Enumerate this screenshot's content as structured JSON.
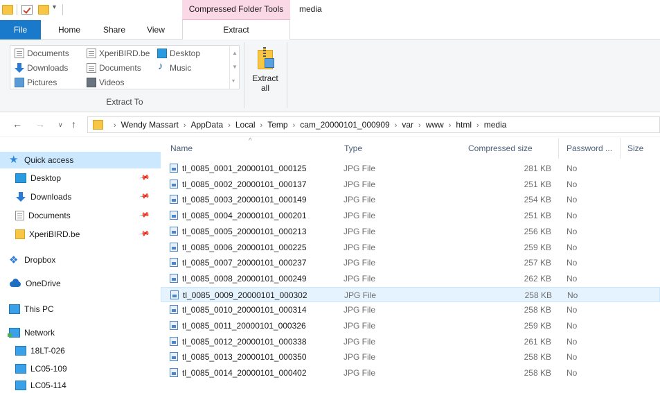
{
  "titlebar": {
    "context_tab": "Compressed Folder Tools",
    "window_title": "media"
  },
  "tabs": {
    "file": "File",
    "home": "Home",
    "share": "Share",
    "view": "View",
    "extract": "Extract"
  },
  "ribbon": {
    "destinations": [
      {
        "label": "Documents",
        "icon": "documents-icon"
      },
      {
        "label": "XperiBIRD.be",
        "icon": "folder-icon"
      },
      {
        "label": "Desktop",
        "icon": "desktop-icon"
      },
      {
        "label": "Downloads",
        "icon": "downloads-icon"
      },
      {
        "label": "Documents",
        "icon": "documents-icon"
      },
      {
        "label": "Music",
        "icon": "music-icon"
      },
      {
        "label": "Pictures",
        "icon": "pictures-icon"
      },
      {
        "label": "Videos",
        "icon": "videos-icon"
      }
    ],
    "group_label": "Extract To",
    "extract_all_line1": "Extract",
    "extract_all_line2": "all"
  },
  "address": {
    "crumbs": [
      "Wendy Massart",
      "AppData",
      "Local",
      "Temp",
      "cam_20000101_000909",
      "var",
      "www",
      "html",
      "media"
    ]
  },
  "nav": {
    "quick_access": "Quick access",
    "pinned": [
      {
        "label": "Desktop",
        "icon": "desktop-icon"
      },
      {
        "label": "Downloads",
        "icon": "downloads-icon"
      },
      {
        "label": "Documents",
        "icon": "documents-icon"
      },
      {
        "label": "XperiBIRD.be",
        "icon": "folder-icon"
      }
    ],
    "dropbox": "Dropbox",
    "onedrive": "OneDrive",
    "this_pc": "This PC",
    "network": "Network",
    "computers": [
      "18LT-026",
      "LC05-109",
      "LC05-114"
    ]
  },
  "columns": {
    "name": "Name",
    "type": "Type",
    "compressed_size": "Compressed size",
    "password": "Password ...",
    "size": "Size"
  },
  "files": [
    {
      "name": "tl_0085_0001_20000101_000125",
      "type": "JPG File",
      "csize": "281 KB",
      "password": "No"
    },
    {
      "name": "tl_0085_0002_20000101_000137",
      "type": "JPG File",
      "csize": "251 KB",
      "password": "No"
    },
    {
      "name": "tl_0085_0003_20000101_000149",
      "type": "JPG File",
      "csize": "254 KB",
      "password": "No"
    },
    {
      "name": "tl_0085_0004_20000101_000201",
      "type": "JPG File",
      "csize": "251 KB",
      "password": "No"
    },
    {
      "name": "tl_0085_0005_20000101_000213",
      "type": "JPG File",
      "csize": "256 KB",
      "password": "No"
    },
    {
      "name": "tl_0085_0006_20000101_000225",
      "type": "JPG File",
      "csize": "259 KB",
      "password": "No"
    },
    {
      "name": "tl_0085_0007_20000101_000237",
      "type": "JPG File",
      "csize": "257 KB",
      "password": "No"
    },
    {
      "name": "tl_0085_0008_20000101_000249",
      "type": "JPG File",
      "csize": "262 KB",
      "password": "No"
    },
    {
      "name": "tl_0085_0009_20000101_000302",
      "type": "JPG File",
      "csize": "258 KB",
      "password": "No"
    },
    {
      "name": "tl_0085_0010_20000101_000314",
      "type": "JPG File",
      "csize": "258 KB",
      "password": "No"
    },
    {
      "name": "tl_0085_0011_20000101_000326",
      "type": "JPG File",
      "csize": "259 KB",
      "password": "No"
    },
    {
      "name": "tl_0085_0012_20000101_000338",
      "type": "JPG File",
      "csize": "261 KB",
      "password": "No"
    },
    {
      "name": "tl_0085_0013_20000101_000350",
      "type": "JPG File",
      "csize": "258 KB",
      "password": "No"
    },
    {
      "name": "tl_0085_0014_20000101_000402",
      "type": "JPG File",
      "csize": "258 KB",
      "password": "No"
    }
  ],
  "hovered_row": 8
}
